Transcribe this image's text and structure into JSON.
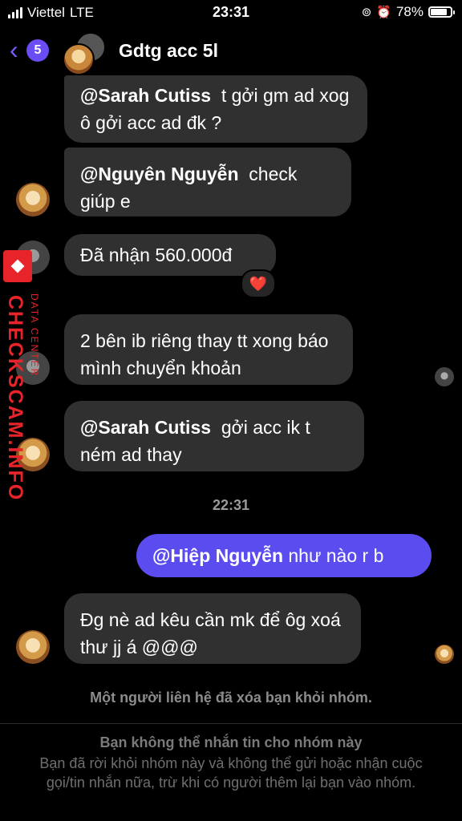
{
  "status_bar": {
    "carrier": "Viettel",
    "network": "LTE",
    "time": "23:31",
    "battery": "78%"
  },
  "header": {
    "back_count": "5",
    "title": "Gdtg acc 5l"
  },
  "messages": [
    {
      "mention": "@Sarah Cutiss",
      "text": "t gởi gm ad xog ô gởi acc ad đk ?"
    },
    {
      "mention": "@Nguyên Nguyễn",
      "text": "check giúp e"
    },
    {
      "mention": "",
      "text": "Đã nhận 560.000đ"
    },
    {
      "mention": "",
      "text": "2 bên ib riêng thay tt xong báo mình chuyển khoản"
    },
    {
      "mention": "@Sarah Cutiss",
      "text": "gởi acc ik t ném ad thay"
    },
    {
      "mention": "",
      "text": "Đg nè ad kêu cần mk để ôg xoá thư jj á @@@"
    }
  ],
  "reaction": {
    "emoji": "❤️",
    "icon": "heart-icon",
    "color": "#e0245e"
  },
  "timestamp": "22:31",
  "outgoing": {
    "mention": "@Hiệp Nguyễn",
    "text": "như nào r b"
  },
  "system_note": "Một người liên hệ đã xóa bạn khỏi nhóm.",
  "footer": {
    "title": "Bạn không thể nhắn tin cho nhóm này",
    "body": "Bạn đã rời khỏi nhóm này và không thể gửi hoặc nhận cuộc gọi/tin nhắn nữa, trừ khi có người thêm lại bạn vào nhóm."
  },
  "watermark": {
    "main": "CHECKSCAM.INFO",
    "sub": "DATA CENTER"
  },
  "colors": {
    "accent": "#6c4df5",
    "outgoing_bubble": "#5b4cf0",
    "incoming_bubble": "#303030",
    "background": "#000000"
  }
}
